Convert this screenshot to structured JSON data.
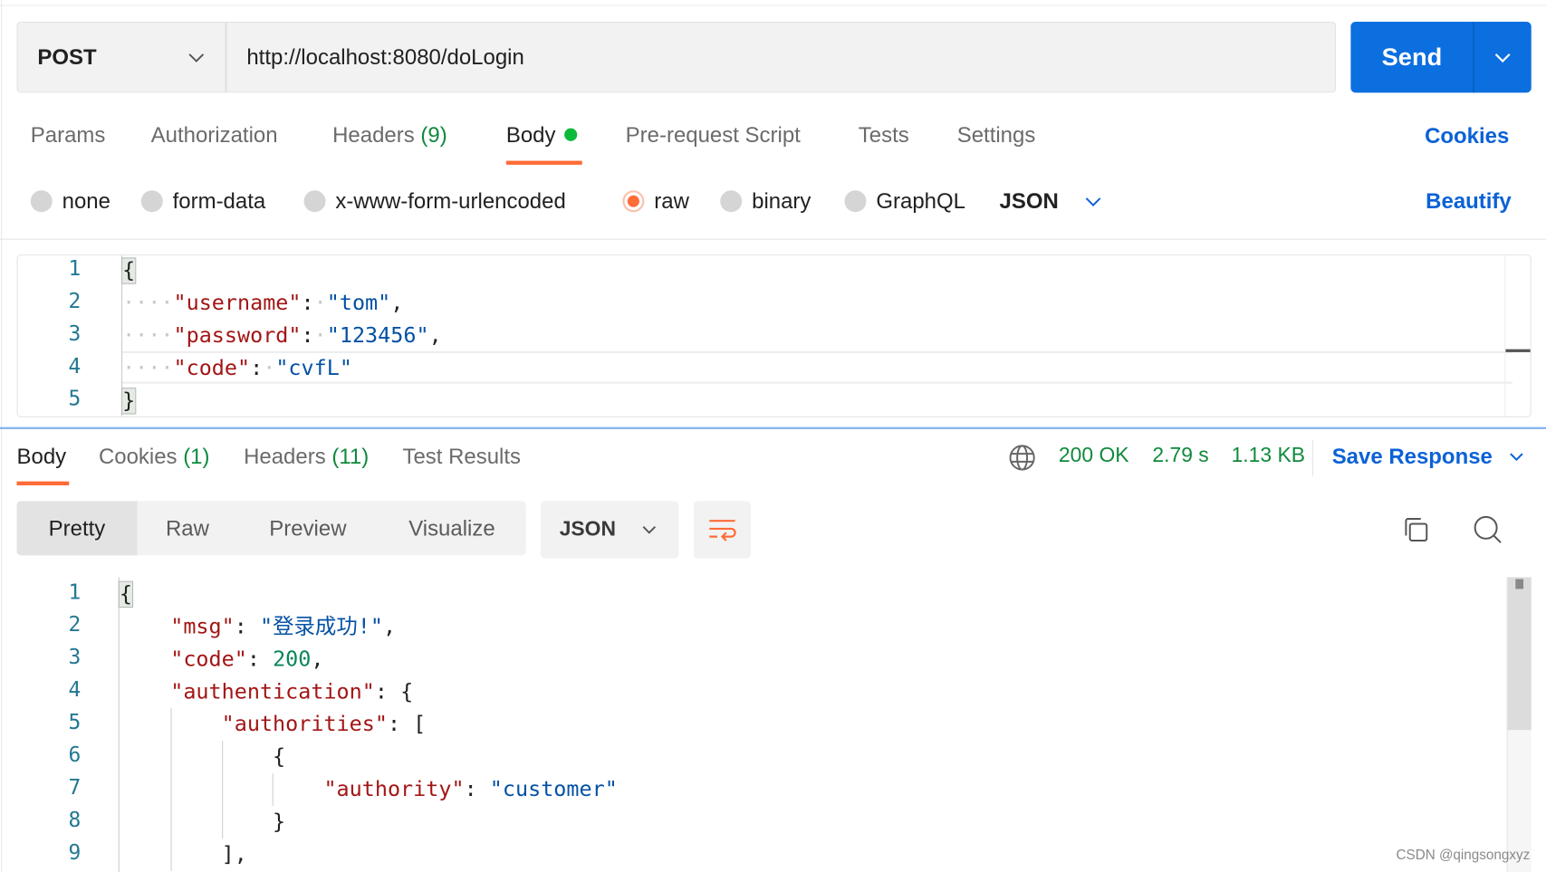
{
  "request": {
    "method": "POST",
    "url": "http://localhost:8080/doLogin",
    "send_label": "Send",
    "tabs": [
      {
        "label": "Params"
      },
      {
        "label": "Authorization"
      },
      {
        "label": "Headers",
        "count": "(9)"
      },
      {
        "label": "Body",
        "active": true
      },
      {
        "label": "Pre-request Script"
      },
      {
        "label": "Tests"
      },
      {
        "label": "Settings"
      }
    ],
    "cookies_link": "Cookies",
    "body_types": [
      {
        "label": "none",
        "selected": false
      },
      {
        "label": "form-data",
        "selected": false
      },
      {
        "label": "x-www-form-urlencoded",
        "selected": false
      },
      {
        "label": "raw",
        "selected": true
      },
      {
        "label": "binary",
        "selected": false
      },
      {
        "label": "GraphQL",
        "selected": false
      }
    ],
    "format": "JSON",
    "beautify_label": "Beautify",
    "body_lines": [
      "{",
      "    \"username\": \"tom\",",
      "    \"password\": \"123456\",",
      "    \"code\": \"cvfL\"",
      "}"
    ]
  },
  "response": {
    "tabs": [
      {
        "label": "Body",
        "active": true
      },
      {
        "label": "Cookies",
        "count": "(1)"
      },
      {
        "label": "Headers",
        "count": "(11)"
      },
      {
        "label": "Test Results"
      }
    ],
    "status": "200 OK",
    "time": "2.79 s",
    "size": "1.13 KB",
    "save_label": "Save Response",
    "views": [
      "Pretty",
      "Raw",
      "Preview",
      "Visualize"
    ],
    "selected_view": "Pretty",
    "format": "JSON",
    "body_lines": [
      "{",
      "    \"msg\": \"登录成功!\",",
      "    \"code\": 200,",
      "    \"authentication\": {",
      "        \"authorities\": [",
      "            {",
      "                \"authority\": \"customer\"",
      "            }",
      "        ],"
    ]
  },
  "colors": {
    "accent": "#ff6c37",
    "primary": "#0b6fe0",
    "status": "#0f8a3c"
  },
  "watermark": "CSDN @qingsongxyz"
}
